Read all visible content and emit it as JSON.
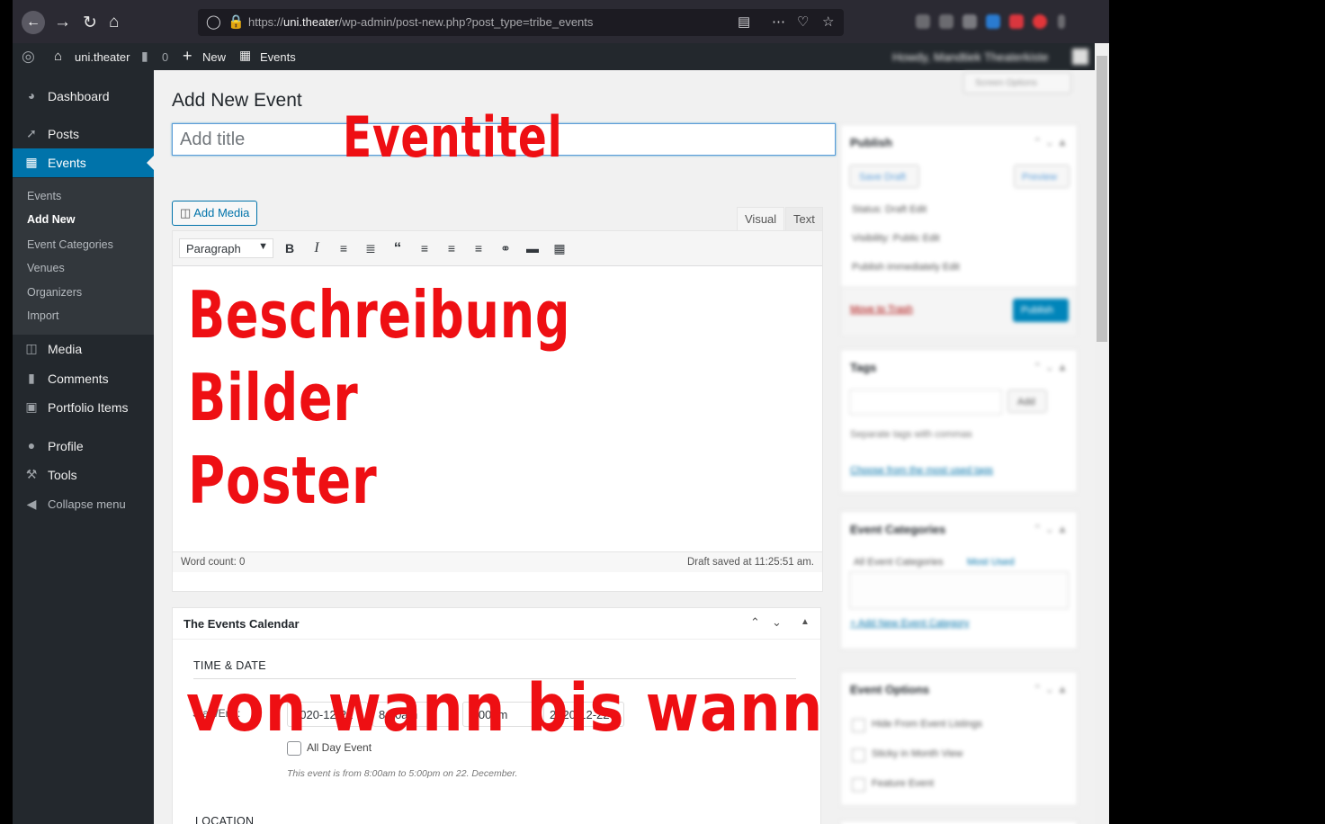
{
  "browser": {
    "url_prefix": "https://",
    "url_domain": "uni.theater",
    "url_path": "/wp-admin/post-new.php?post_type=tribe_events"
  },
  "adminbar": {
    "site_name": "uni.theater",
    "comments_count": "0",
    "new_label": "New",
    "events_label": "Events",
    "greeting": "Howdy, Mandtiek Theaterkiste"
  },
  "sidebar": {
    "items": [
      {
        "label": "Dashboard",
        "icon": "dashboard-icon"
      },
      {
        "label": "Posts",
        "icon": "pin-icon"
      },
      {
        "label": "Events",
        "icon": "calendar-icon"
      },
      {
        "label": "Media",
        "icon": "media-icon"
      },
      {
        "label": "Comments",
        "icon": "comment-icon"
      },
      {
        "label": "Portfolio Items",
        "icon": "portfolio-icon"
      },
      {
        "label": "Profile",
        "icon": "user-icon"
      },
      {
        "label": "Tools",
        "icon": "wrench-icon"
      },
      {
        "label": "Collapse menu",
        "icon": "collapse-icon"
      }
    ],
    "submenu": [
      "Events",
      "Add New",
      "Event Categories",
      "Venues",
      "Organizers",
      "Import"
    ]
  },
  "editor": {
    "page_title": "Add New Event",
    "title_placeholder": "Add title",
    "add_media": "Add Media",
    "tab_visual": "Visual",
    "tab_text": "Text",
    "format": "Paragraph",
    "word_count": "Word count: 0",
    "draft_saved": "Draft saved at 11:25:51 am."
  },
  "annotations": {
    "title": "Eventitel",
    "description_lines": [
      "Beschreibung",
      "Bilder",
      "Poster"
    ],
    "datetime": "von wann bis wann",
    "color": "#ee0f13"
  },
  "events_calendar": {
    "title": "The Events Calendar",
    "time_date_label": "TIME & DATE",
    "start_label": "Start/End:",
    "start_date": "2020-12-22",
    "start_time": "8:00am",
    "end_time": "5:00pm",
    "end_date": "2020-12-22",
    "all_day": "All Day Event",
    "summary": "This event is from 8:00am to 5:00pm on 22. December.",
    "location_label": "LOCATION"
  },
  "right_sidebar": {
    "screen_options": "Screen Options",
    "publish_title": "Publish",
    "save_draft": "Save Draft",
    "preview": "Preview",
    "status": "Status: Draft Edit",
    "visibility": "Visibility: Public Edit",
    "publish_when": "Publish immediately Edit",
    "trash": "Move to Trash",
    "publish_btn": "Publish",
    "tags_title": "Tags",
    "tags_add": "Add",
    "tags_hint": "Separate tags with commas",
    "tags_choose": "Choose from the most used tags",
    "categories_title": "Event Categories",
    "cat_all": "All Event Categories",
    "cat_used": "Most Used",
    "cat_add": "+ Add New Event Category",
    "options_title": "Event Options",
    "opt1": "Hide From Event Listings",
    "opt2": "Sticky in Month View",
    "opt3": "Feature Event"
  },
  "colors": {
    "admin_dark": "#23282d",
    "submenu_bg": "#32373c",
    "accent": "#0073aa",
    "annotation_red": "#ee0f13"
  }
}
